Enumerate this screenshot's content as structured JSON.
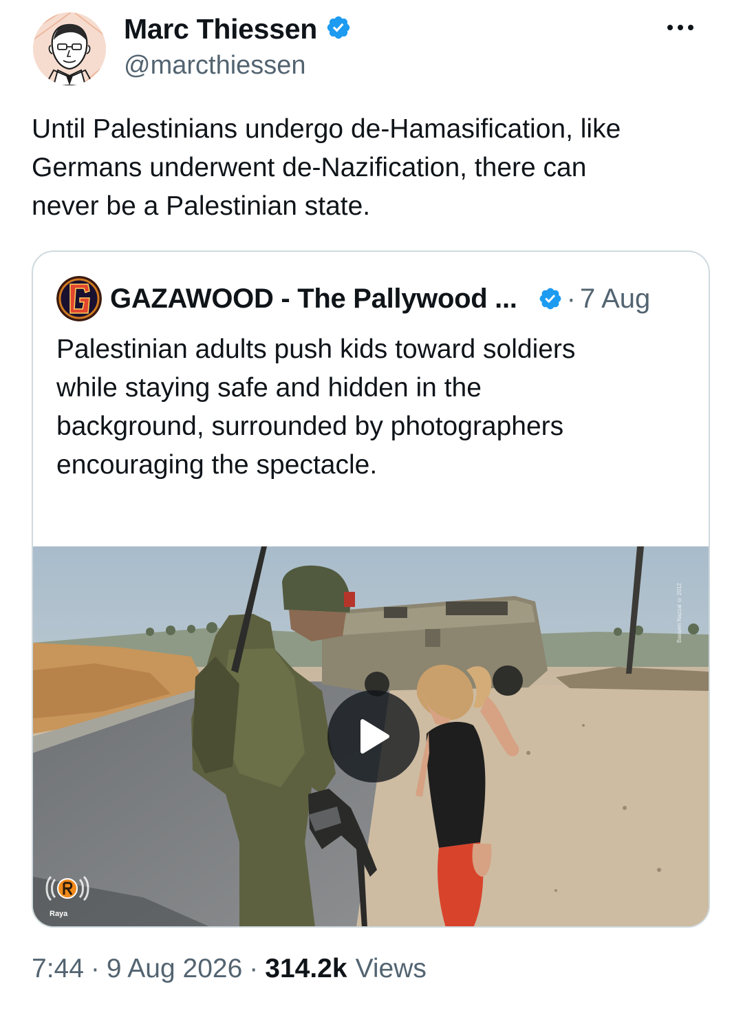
{
  "author": {
    "display_name": "Marc Thiessen",
    "handle": "@marcthiessen",
    "verified_icon": "verified-badge-icon",
    "avatar": "caricature-avatar"
  },
  "more_icon": "more-horizontal-icon",
  "tweet": {
    "text": "Until Palestinians undergo de-Hamasification, like\nGermans underwent de-Nazification, there can\nnever be a Palestinian state."
  },
  "quote": {
    "display_name": "GAZAWOOD - The Pallywood ...",
    "separator": "·",
    "date": "7 Aug",
    "text": "Palestinian adults push kids toward soldiers\nwhile staying safe and hidden in the\nbackground, surrounded by photographers\nencouraging the spectacle.",
    "ellipsis": "...",
    "media": {
      "type": "video",
      "play_icon": "play-icon",
      "watermark_label": "Raya",
      "photo_credit": "Bassem Nazzal © 2012"
    }
  },
  "meta": {
    "time": "7:44",
    "sep1": "·",
    "date": "9 Aug 2026",
    "sep2": "·",
    "views_count": "314.2k",
    "views_label": "Views"
  },
  "colors": {
    "text_primary": "#0f1419",
    "text_secondary": "#536471",
    "verified_blue": "#1d9bf0",
    "border": "#cfd9de"
  }
}
